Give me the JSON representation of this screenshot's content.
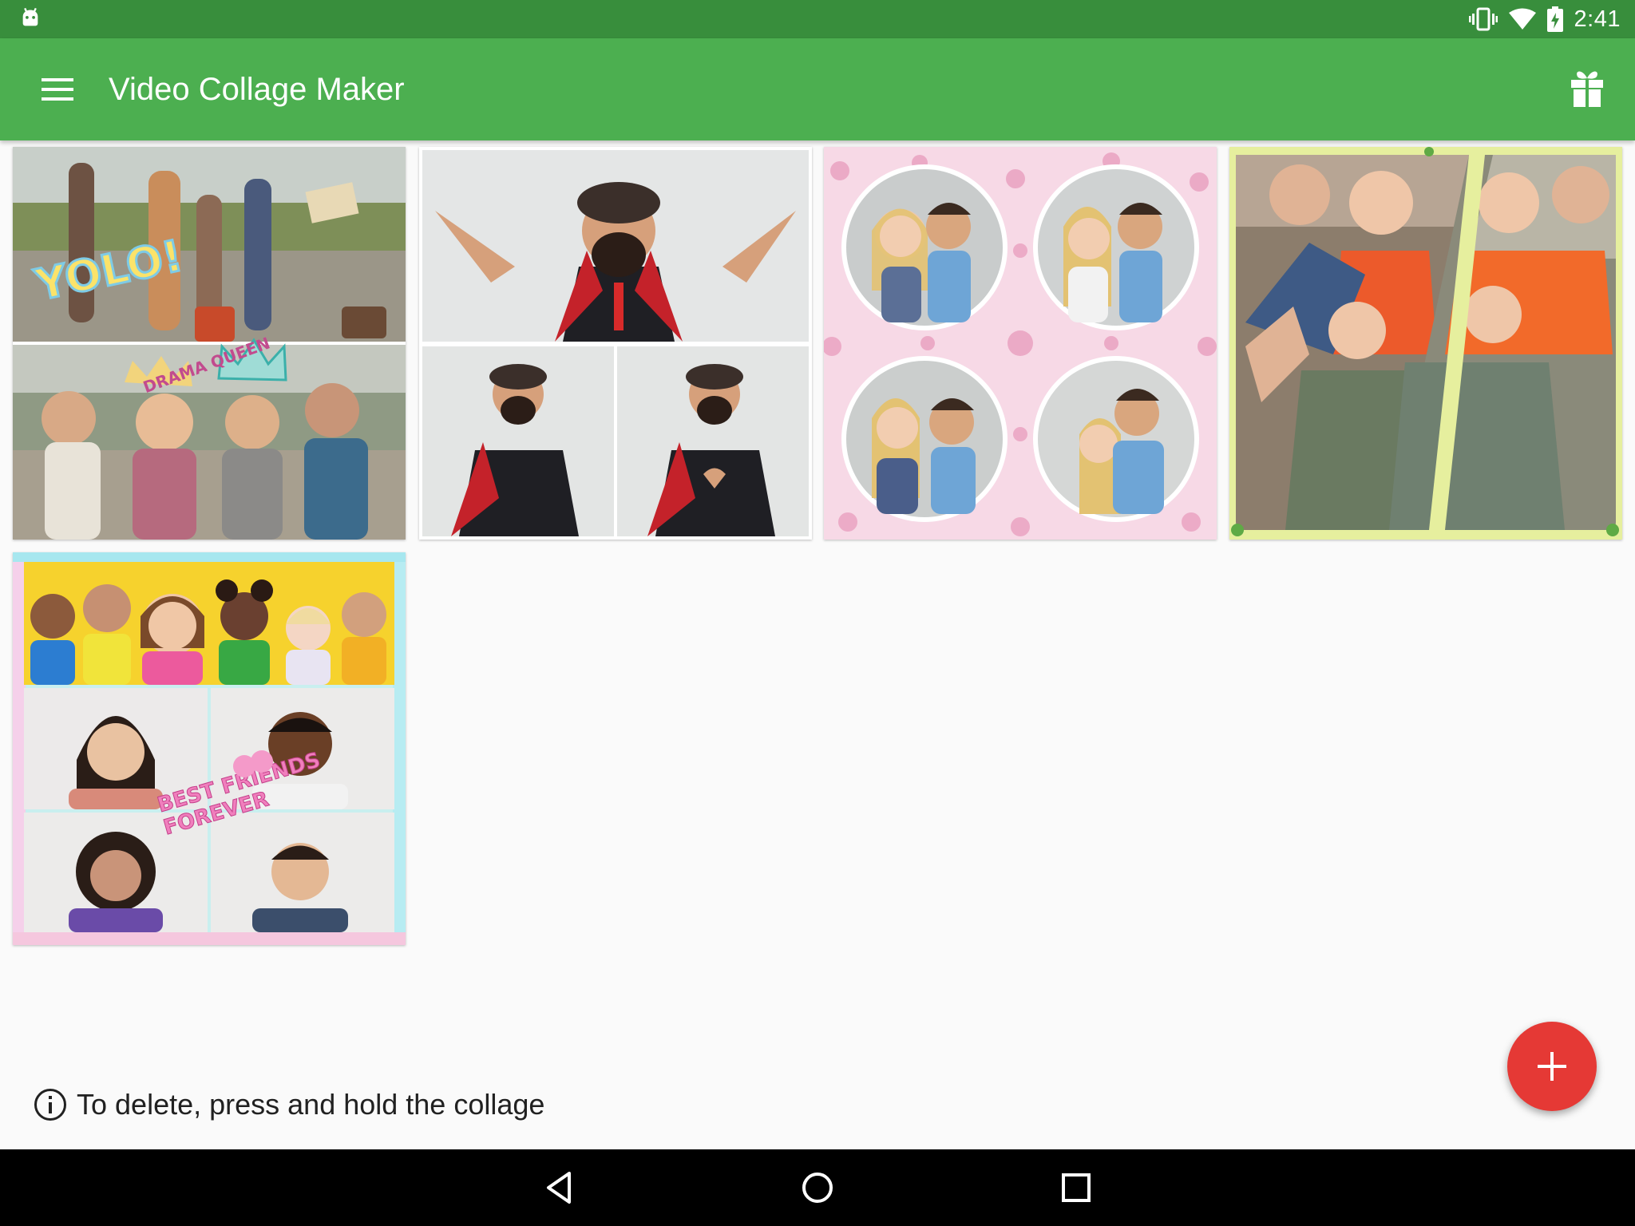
{
  "status_bar": {
    "time": "2:41",
    "icons": [
      "android-debug-icon",
      "vibrate-icon",
      "wifi-icon",
      "battery-charging-icon"
    ]
  },
  "app_bar": {
    "title": "Video Collage Maker",
    "menu_icon": "hamburger-menu-icon",
    "action_icon": "gift-icon"
  },
  "collages": [
    {
      "name": "collage-hippie-friends",
      "stickers": [
        "YOLO!",
        "DRAMA QUEEN"
      ]
    },
    {
      "name": "collage-aviator-superhero",
      "stickers": []
    },
    {
      "name": "collage-couple-circles",
      "stickers": []
    },
    {
      "name": "collage-family-selfie",
      "stickers": []
    },
    {
      "name": "collage-kids-best-friends",
      "stickers": [
        "BEST FRIENDS FOREVER"
      ]
    }
  ],
  "hint": {
    "icon": "info-icon",
    "text": "To delete, press and hold the collage"
  },
  "fab": {
    "icon": "plus-icon"
  },
  "nav_bar": {
    "icons": [
      "back-icon",
      "home-icon",
      "recents-icon"
    ]
  },
  "colors": {
    "status_bar": "#388e3c",
    "app_bar": "#4caf50",
    "fab": "#e53935",
    "background": "#fafafa",
    "nav_bar": "#000000"
  }
}
